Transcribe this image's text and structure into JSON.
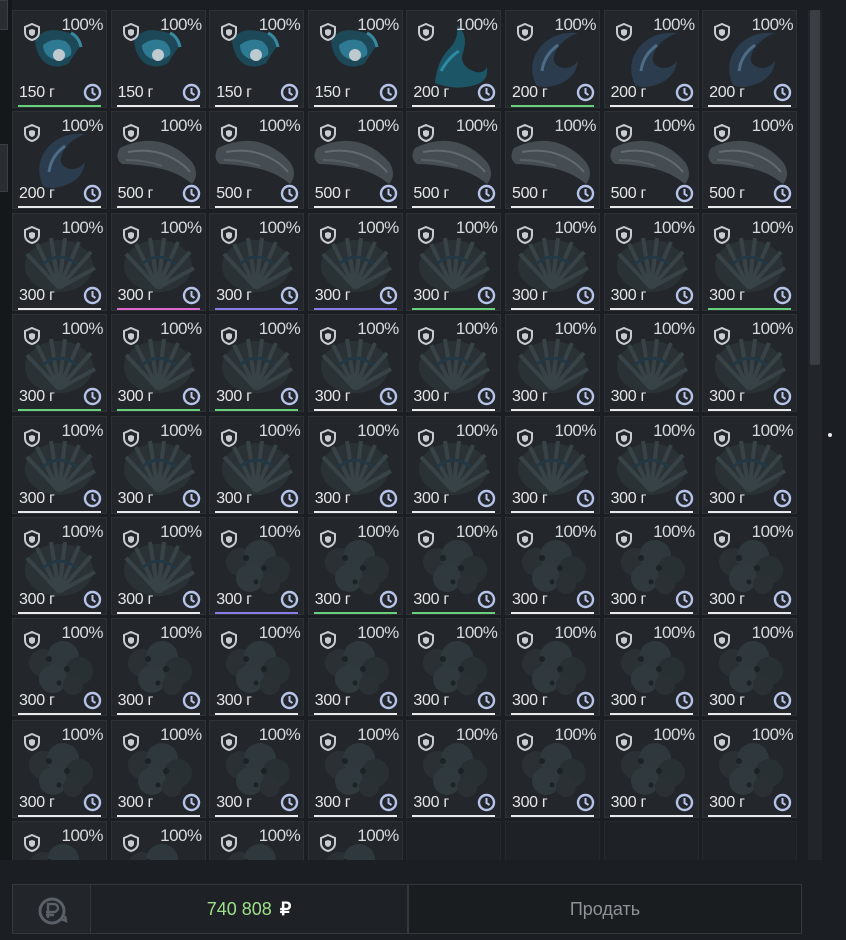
{
  "items": [
    {
      "durability": "100%",
      "weight": "150 г",
      "art": "gem",
      "bar": "#66d07a"
    },
    {
      "durability": "100%",
      "weight": "150 г",
      "art": "gem",
      "bar": "#e8eaec"
    },
    {
      "durability": "100%",
      "weight": "150 г",
      "art": "gem",
      "bar": "#e8eaec"
    },
    {
      "durability": "100%",
      "weight": "150 г",
      "art": "gem",
      "bar": "#e8eaec"
    },
    {
      "durability": "100%",
      "weight": "200 г",
      "art": "claw",
      "bar": "#e8eaec"
    },
    {
      "durability": "100%",
      "weight": "200 г",
      "art": "hook",
      "bar": "#66d07a"
    },
    {
      "durability": "100%",
      "weight": "200 г",
      "art": "hook",
      "bar": "#e8eaec"
    },
    {
      "durability": "100%",
      "weight": "200 г",
      "art": "hook",
      "bar": "#e8eaec"
    },
    {
      "durability": "100%",
      "weight": "200 г",
      "art": "hook",
      "bar": "#e8eaec"
    },
    {
      "durability": "100%",
      "weight": "500 г",
      "art": "log",
      "bar": "#e8eaec"
    },
    {
      "durability": "100%",
      "weight": "500 г",
      "art": "log",
      "bar": "#e8eaec"
    },
    {
      "durability": "100%",
      "weight": "500 г",
      "art": "log",
      "bar": "#e8eaec"
    },
    {
      "durability": "100%",
      "weight": "500 г",
      "art": "log",
      "bar": "#e8eaec"
    },
    {
      "durability": "100%",
      "weight": "500 г",
      "art": "log",
      "bar": "#e8eaec"
    },
    {
      "durability": "100%",
      "weight": "500 г",
      "art": "log",
      "bar": "#e8eaec"
    },
    {
      "durability": "100%",
      "weight": "500 г",
      "art": "log",
      "bar": "#e8eaec"
    },
    {
      "durability": "100%",
      "weight": "300 г",
      "art": "fan",
      "bar": "#e8eaec"
    },
    {
      "durability": "100%",
      "weight": "300 г",
      "art": "fan",
      "bar": "#e06ad0"
    },
    {
      "durability": "100%",
      "weight": "300 г",
      "art": "fan",
      "bar": "#8a7ce8"
    },
    {
      "durability": "100%",
      "weight": "300 г",
      "art": "fan",
      "bar": "#8a7ce8"
    },
    {
      "durability": "100%",
      "weight": "300 г",
      "art": "fan",
      "bar": "#66d07a"
    },
    {
      "durability": "100%",
      "weight": "300 г",
      "art": "fan",
      "bar": "#e8eaec"
    },
    {
      "durability": "100%",
      "weight": "300 г",
      "art": "fan",
      "bar": "#e8eaec"
    },
    {
      "durability": "100%",
      "weight": "300 г",
      "art": "fan",
      "bar": "#66d07a"
    },
    {
      "durability": "100%",
      "weight": "300 г",
      "art": "fan",
      "bar": "#66d07a"
    },
    {
      "durability": "100%",
      "weight": "300 г",
      "art": "fan",
      "bar": "#66d07a"
    },
    {
      "durability": "100%",
      "weight": "300 г",
      "art": "fan",
      "bar": "#66d07a"
    },
    {
      "durability": "100%",
      "weight": "300 г",
      "art": "fan",
      "bar": "#e8eaec"
    },
    {
      "durability": "100%",
      "weight": "300 г",
      "art": "fan",
      "bar": "#e8eaec"
    },
    {
      "durability": "100%",
      "weight": "300 г",
      "art": "fan",
      "bar": "#e8eaec"
    },
    {
      "durability": "100%",
      "weight": "300 г",
      "art": "fan",
      "bar": "#e8eaec"
    },
    {
      "durability": "100%",
      "weight": "300 г",
      "art": "fan",
      "bar": "#e8eaec"
    },
    {
      "durability": "100%",
      "weight": "300 г",
      "art": "fan",
      "bar": "#e8eaec"
    },
    {
      "durability": "100%",
      "weight": "300 г",
      "art": "fan",
      "bar": "#e8eaec"
    },
    {
      "durability": "100%",
      "weight": "300 г",
      "art": "fan",
      "bar": "#e8eaec"
    },
    {
      "durability": "100%",
      "weight": "300 г",
      "art": "fan",
      "bar": "#e8eaec"
    },
    {
      "durability": "100%",
      "weight": "300 г",
      "art": "fan",
      "bar": "#e8eaec"
    },
    {
      "durability": "100%",
      "weight": "300 г",
      "art": "fan",
      "bar": "#e8eaec"
    },
    {
      "durability": "100%",
      "weight": "300 г",
      "art": "fan",
      "bar": "#e8eaec"
    },
    {
      "durability": "100%",
      "weight": "300 г",
      "art": "fan",
      "bar": "#e8eaec"
    },
    {
      "durability": "100%",
      "weight": "300 г",
      "art": "fan",
      "bar": "#e8eaec"
    },
    {
      "durability": "100%",
      "weight": "300 г",
      "art": "fan",
      "bar": "#e8eaec"
    },
    {
      "durability": "100%",
      "weight": "300 г",
      "art": "rock",
      "bar": "#8a7ce8"
    },
    {
      "durability": "100%",
      "weight": "300 г",
      "art": "rock",
      "bar": "#66d07a"
    },
    {
      "durability": "100%",
      "weight": "300 г",
      "art": "rock",
      "bar": "#66d07a"
    },
    {
      "durability": "100%",
      "weight": "300 г",
      "art": "rock",
      "bar": "#e8eaec"
    },
    {
      "durability": "100%",
      "weight": "300 г",
      "art": "rock",
      "bar": "#e8eaec"
    },
    {
      "durability": "100%",
      "weight": "300 г",
      "art": "rock",
      "bar": "#e8eaec"
    },
    {
      "durability": "100%",
      "weight": "300 г",
      "art": "rock",
      "bar": "#e8eaec"
    },
    {
      "durability": "100%",
      "weight": "300 г",
      "art": "rock",
      "bar": "#e8eaec"
    },
    {
      "durability": "100%",
      "weight": "300 г",
      "art": "rock",
      "bar": "#e8eaec"
    },
    {
      "durability": "100%",
      "weight": "300 г",
      "art": "rock",
      "bar": "#e8eaec"
    },
    {
      "durability": "100%",
      "weight": "300 г",
      "art": "rock",
      "bar": "#e8eaec"
    },
    {
      "durability": "100%",
      "weight": "300 г",
      "art": "rock",
      "bar": "#e8eaec"
    },
    {
      "durability": "100%",
      "weight": "300 г",
      "art": "rock",
      "bar": "#e8eaec"
    },
    {
      "durability": "100%",
      "weight": "300 г",
      "art": "rock",
      "bar": "#e8eaec"
    },
    {
      "durability": "100%",
      "weight": "300 г",
      "art": "rock",
      "bar": "#e8eaec"
    },
    {
      "durability": "100%",
      "weight": "300 г",
      "art": "rock",
      "bar": "#e8eaec"
    },
    {
      "durability": "100%",
      "weight": "300 г",
      "art": "rock",
      "bar": "#e8eaec"
    },
    {
      "durability": "100%",
      "weight": "300 г",
      "art": "rock",
      "bar": "#e8eaec"
    },
    {
      "durability": "100%",
      "weight": "300 г",
      "art": "rock",
      "bar": "#e8eaec"
    },
    {
      "durability": "100%",
      "weight": "300 г",
      "art": "rock",
      "bar": "#e8eaec"
    },
    {
      "durability": "100%",
      "weight": "300 г",
      "art": "rock",
      "bar": "#e8eaec"
    },
    {
      "durability": "100%",
      "weight": "300 г",
      "art": "rock",
      "bar": "#e8eaec"
    },
    {
      "durability": "100%",
      "weight": "",
      "art": "rock",
      "bar": ""
    },
    {
      "durability": "100%",
      "weight": "",
      "art": "rock",
      "bar": ""
    },
    {
      "durability": "100%",
      "weight": "",
      "art": "rock",
      "bar": ""
    },
    {
      "durability": "100%",
      "weight": "",
      "art": "rock",
      "bar": ""
    },
    {
      "empty": true
    },
    {
      "empty": true
    },
    {
      "empty": true
    },
    {
      "empty": true
    }
  ],
  "footer": {
    "currency_icon": "ruble-refresh-icon",
    "total_value": "740 808",
    "total_currency": "₽",
    "sell_label": "Продать"
  },
  "colors": {
    "accent_green": "#9ee08a",
    "rarity_green": "#66d07a",
    "rarity_purple": "#8a7ce8",
    "rarity_pink": "#e06ad0"
  }
}
